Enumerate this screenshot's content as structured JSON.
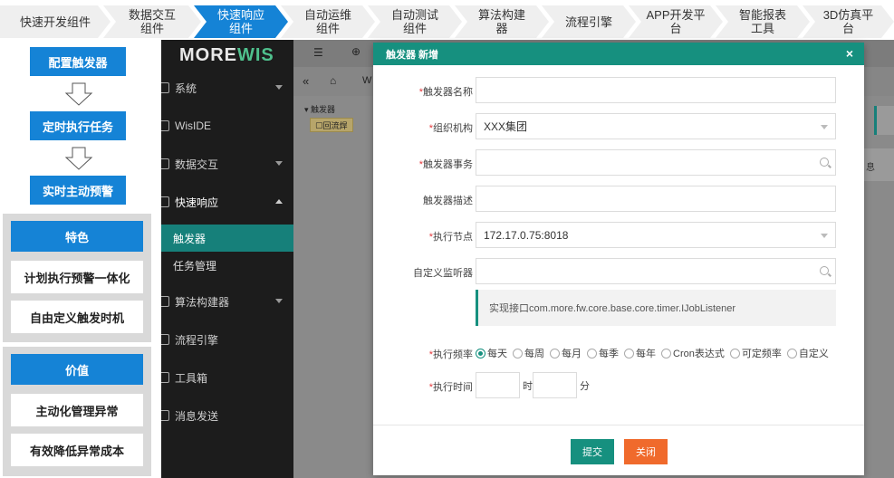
{
  "steps": [
    {
      "label": "快速开发组件"
    },
    {
      "label": "数据交互\n组件"
    },
    {
      "label": "快速响应\n组件"
    },
    {
      "label": "自动运维\n组件"
    },
    {
      "label": "自动测试\n组件"
    },
    {
      "label": "算法构建\n器"
    },
    {
      "label": "流程引擎"
    },
    {
      "label": "APP开发平\n台"
    },
    {
      "label": "智能报表\n工具"
    },
    {
      "label": "3D仿真平\n台"
    }
  ],
  "active_step_index": 2,
  "left_panel": {
    "flow": [
      "配置触发器",
      "定时执行任务",
      "实时主动预警"
    ],
    "features": {
      "title": "特色",
      "items": [
        "计划执行预警一体化",
        "自由定义触发时机"
      ]
    },
    "value": {
      "title": "价值",
      "items": [
        "主动化管理异常",
        "有效降低异常成本"
      ]
    }
  },
  "app": {
    "logo_text": "MORE",
    "logo_accent": "WIS",
    "nav": [
      {
        "label": "系统",
        "expandable": true
      },
      {
        "label": "WisIDE",
        "expandable": false
      },
      {
        "label": "数据交互",
        "expandable": true
      },
      {
        "label": "快速响应",
        "expandable": true,
        "expanded": true
      },
      {
        "label": "算法构建器",
        "expandable": true
      },
      {
        "label": "流程引擎",
        "expandable": false
      },
      {
        "label": "工具箱",
        "expandable": false
      },
      {
        "label": "消息发送",
        "expandable": false
      }
    ],
    "sub_nav": [
      {
        "label": "触发器",
        "active": true
      },
      {
        "label": "任务管理",
        "active": false
      }
    ],
    "tree_root": "触发器",
    "tree_node": "回流焊",
    "tab_fragment": "W",
    "right_fragment": "息"
  },
  "modal": {
    "title": "触发器 新增",
    "close_glyph": "×",
    "fields": {
      "name_label": "触发器名称",
      "name_value": "",
      "org_label": "组织机构",
      "org_value": "XXX集团",
      "event_label": "触发器事务",
      "event_value": "",
      "desc_label": "触发器描述",
      "desc_value": "",
      "node_label": "执行节点",
      "node_value": "172.17.0.75:8018",
      "listener_label": "自定义监听器",
      "listener_value": ""
    },
    "hint": "实现接口com.more.fw.core.base.core.timer.IJobListener",
    "freq_label": "执行频率",
    "freq_options": [
      "每天",
      "每周",
      "每月",
      "每季",
      "每年",
      "Cron表达式",
      "可定频率",
      "自定义"
    ],
    "freq_selected": "每天",
    "time_label": "执行时间",
    "hour_unit": "时",
    "minute_unit": "分",
    "submit_label": "提交",
    "close_label": "关闭"
  },
  "colors": {
    "step_active": "#1583d6",
    "teal": "#16907f",
    "orange": "#f06a2c",
    "required": "#e4393c"
  }
}
